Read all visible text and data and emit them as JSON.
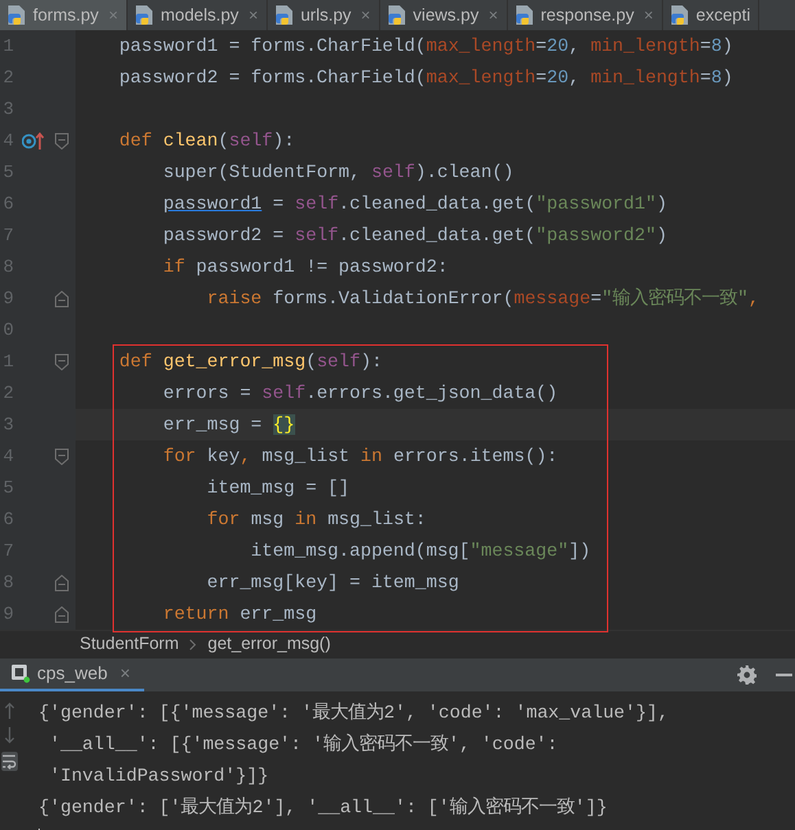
{
  "tabs": [
    {
      "label": "forms.py",
      "close": "×",
      "selected": true
    },
    {
      "label": "models.py",
      "close": "×",
      "selected": false
    },
    {
      "label": "urls.py",
      "close": "×",
      "selected": false
    },
    {
      "label": "views.py",
      "close": "×",
      "selected": false
    },
    {
      "label": "response.py",
      "close": "×",
      "selected": false
    },
    {
      "label": "excepti",
      "selected": false
    }
  ],
  "editor": {
    "blocks": [
      {
        "boxed": false,
        "lines": [
          {
            "number": "1",
            "tokens": [
              {
                "text": "    password1 = forms.CharField(",
                "kind": "plain"
              },
              {
                "text": "max_length",
                "kind": "param"
              },
              {
                "text": "=",
                "kind": "plain"
              },
              {
                "text": "20",
                "kind": "number"
              },
              {
                "text": ", ",
                "kind": "plain"
              },
              {
                "text": "min_length",
                "kind": "param"
              },
              {
                "text": "=",
                "kind": "plain"
              },
              {
                "text": "8",
                "kind": "number"
              },
              {
                "text": ")",
                "kind": "plain"
              }
            ]
          },
          {
            "number": "2",
            "tokens": [
              {
                "text": "    password2 = forms.CharField(",
                "kind": "plain"
              },
              {
                "text": "max_length",
                "kind": "param"
              },
              {
                "text": "=",
                "kind": "plain"
              },
              {
                "text": "20",
                "kind": "number"
              },
              {
                "text": ", ",
                "kind": "plain"
              },
              {
                "text": "min_length",
                "kind": "param"
              },
              {
                "text": "=",
                "kind": "plain"
              },
              {
                "text": "8",
                "kind": "number"
              },
              {
                "text": ")",
                "kind": "plain"
              }
            ]
          },
          {
            "number": "3"
          },
          {
            "number": "4",
            "overrides": true,
            "fold_start": true,
            "tokens": [
              {
                "text": "    def ",
                "kind": "keyword"
              },
              {
                "text": "clean",
                "kind": "func"
              },
              {
                "text": "(",
                "kind": "plain"
              },
              {
                "text": "self",
                "kind": "self"
              },
              {
                "text": "):",
                "kind": "plain"
              }
            ]
          },
          {
            "number": "5",
            "tokens": [
              {
                "text": "        super",
                "kind": "plain"
              },
              {
                "text": "(StudentForm, ",
                "kind": "plain"
              },
              {
                "text": "self",
                "kind": "self"
              },
              {
                "text": ").clean()",
                "kind": "plain"
              }
            ]
          },
          {
            "number": "6",
            "tokens": [
              {
                "text": "        password1",
                "kind": "link"
              },
              {
                "text": " = ",
                "kind": "plain"
              },
              {
                "text": "self",
                "kind": "self"
              },
              {
                "text": ".cleaned_data.get(",
                "kind": "plain"
              },
              {
                "text": "\"password1\"",
                "kind": "string"
              },
              {
                "text": ")",
                "kind": "plain"
              }
            ]
          },
          {
            "number": "7",
            "tokens": [
              {
                "text": "        password2 = ",
                "kind": "plain"
              },
              {
                "text": "self",
                "kind": "self"
              },
              {
                "text": ".cleaned_data.get(",
                "kind": "plain"
              },
              {
                "text": "\"password2\"",
                "kind": "string"
              },
              {
                "text": ")",
                "kind": "plain"
              }
            ]
          },
          {
            "number": "8",
            "tokens": [
              {
                "text": "        if ",
                "kind": "keyword"
              },
              {
                "text": "password1 != password2:",
                "kind": "plain"
              }
            ]
          },
          {
            "number": "9",
            "fold_end": true,
            "tokens": [
              {
                "text": "            raise ",
                "kind": "keyword"
              },
              {
                "text": "forms.ValidationError(",
                "kind": "plain"
              },
              {
                "text": "message",
                "kind": "param"
              },
              {
                "text": "=",
                "kind": "plain"
              },
              {
                "text": "\"输入密码不一致\"",
                "kind": "string"
              },
              {
                "text": ",",
                "kind": "keyword"
              }
            ]
          },
          {
            "number": "0"
          }
        ]
      },
      {
        "boxed": true,
        "lines": [
          {
            "number": "1",
            "fold_start": true,
            "tokens": [
              {
                "text": "    def ",
                "kind": "keyword"
              },
              {
                "text": "get_error_msg",
                "kind": "func"
              },
              {
                "text": "(",
                "kind": "plain"
              },
              {
                "text": "self",
                "kind": "self"
              },
              {
                "text": "):",
                "kind": "plain"
              }
            ]
          },
          {
            "number": "2",
            "tokens": [
              {
                "text": "        errors = ",
                "kind": "plain"
              },
              {
                "text": "self",
                "kind": "self"
              },
              {
                "text": ".errors.get_json_data()",
                "kind": "plain"
              }
            ]
          },
          {
            "number": "3",
            "current": true,
            "tokens": [
              {
                "text": "        err_msg = ",
                "kind": "plain"
              },
              {
                "text": "{}",
                "kind": "brace"
              }
            ]
          },
          {
            "number": "4",
            "fold_start": true,
            "tokens": [
              {
                "text": "        for ",
                "kind": "keyword"
              },
              {
                "text": "key",
                "kind": "plain"
              },
              {
                "text": ", ",
                "kind": "keyword"
              },
              {
                "text": "msg_list ",
                "kind": "plain"
              },
              {
                "text": "in ",
                "kind": "keyword"
              },
              {
                "text": "errors.items():",
                "kind": "plain"
              }
            ]
          },
          {
            "number": "5",
            "tokens": [
              {
                "text": "            item_msg = []",
                "kind": "plain"
              }
            ]
          },
          {
            "number": "6",
            "tokens": [
              {
                "text": "            for ",
                "kind": "keyword"
              },
              {
                "text": "msg ",
                "kind": "plain"
              },
              {
                "text": "in ",
                "kind": "keyword"
              },
              {
                "text": "msg_list:",
                "kind": "plain"
              }
            ]
          },
          {
            "number": "7",
            "tokens": [
              {
                "text": "                item_msg.append(msg[",
                "kind": "plain"
              },
              {
                "text": "\"message\"",
                "kind": "string"
              },
              {
                "text": "])",
                "kind": "plain"
              }
            ]
          },
          {
            "number": "8",
            "fold_end": true,
            "tokens": [
              {
                "text": "            err_msg[key] = item_msg",
                "kind": "plain"
              }
            ]
          },
          {
            "number": "9",
            "fold_end": true,
            "tokens": [
              {
                "text": "        return ",
                "kind": "keyword"
              },
              {
                "text": "err_msg",
                "kind": "plain"
              }
            ]
          }
        ]
      }
    ]
  },
  "breadcrumb": [
    "StudentForm",
    "get_error_msg()"
  ],
  "run_panel": {
    "tab": {
      "label": "cps_web",
      "close": "×",
      "selected": true
    },
    "lines": [
      "{'gender': [{'message': '最大值为2', 'code': 'max_value'}],",
      " '__all__': [{'message': '输入密码不一致', 'code':",
      " 'InvalidPassword'}]}",
      "{'gender': ['最大值为2'], '__all__': ['输入密码不一致']}"
    ]
  }
}
